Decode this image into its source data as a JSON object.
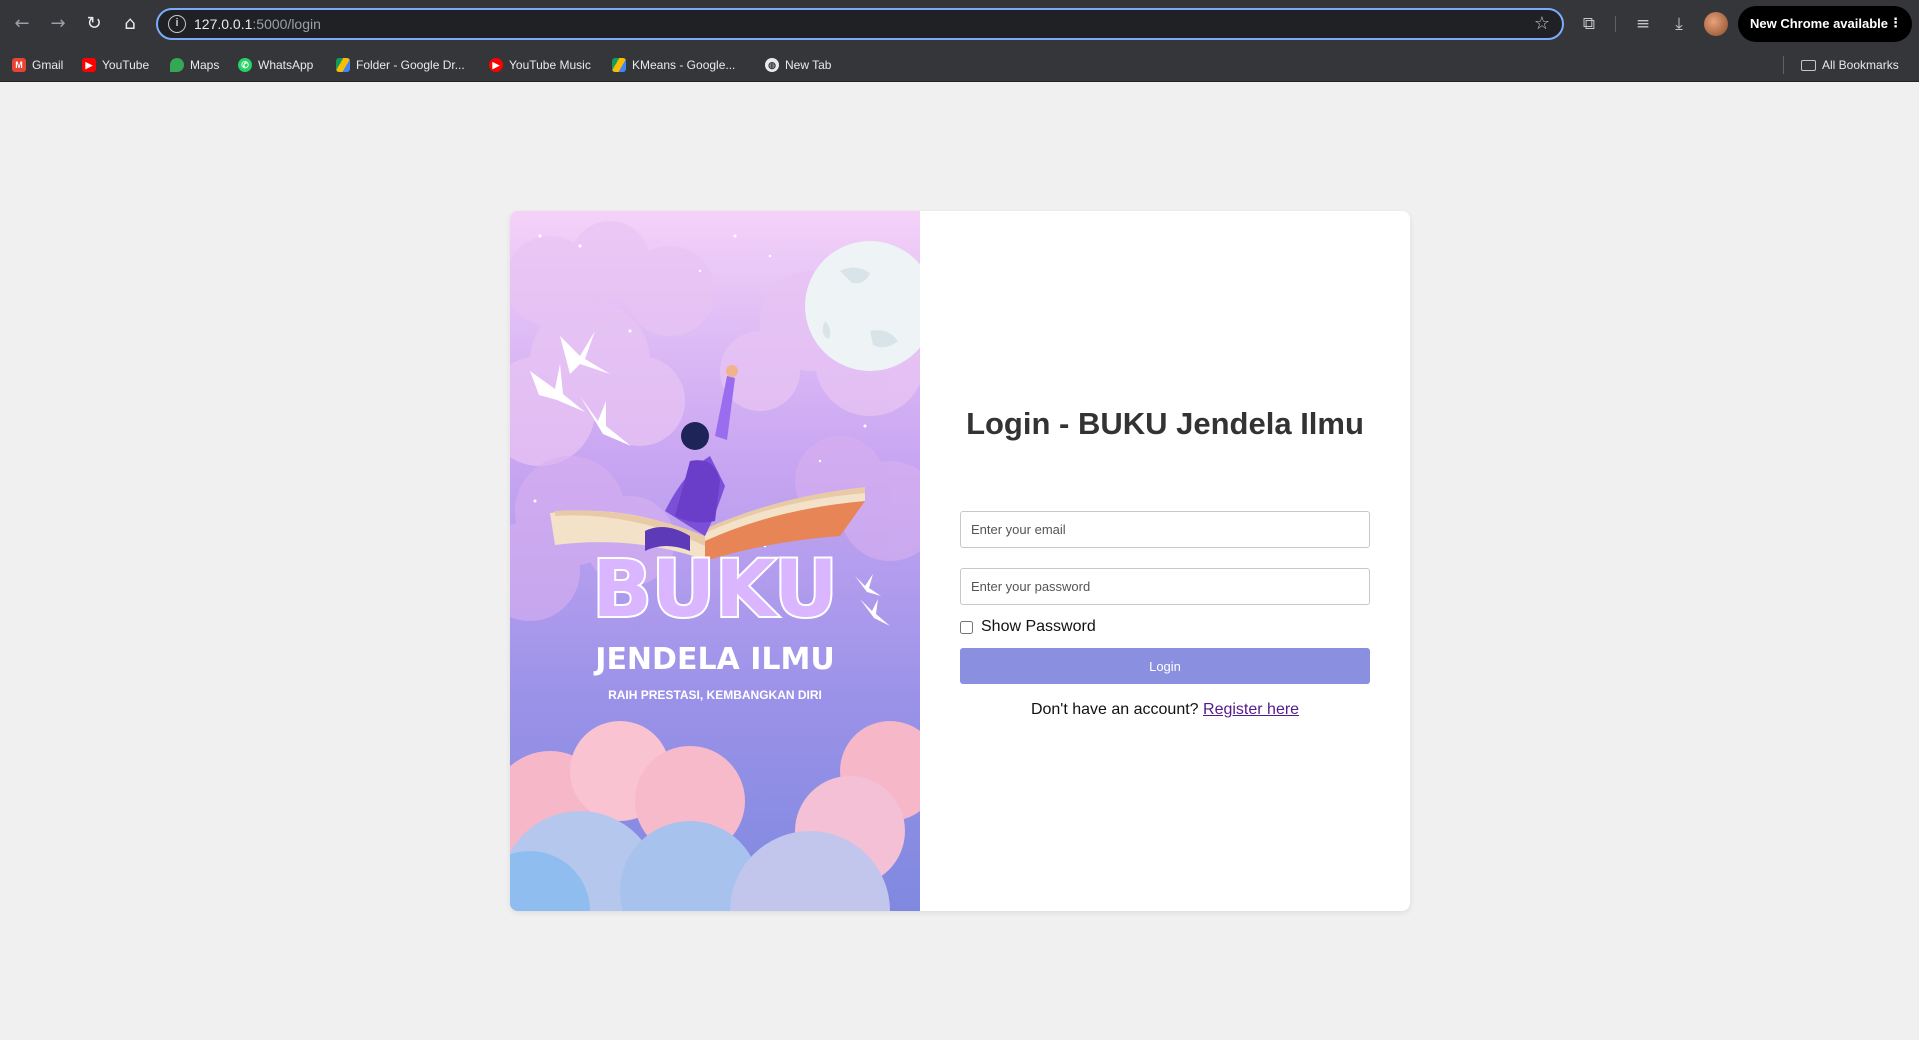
{
  "browser": {
    "url_host": "127.0.0.1",
    "url_path": ":5000/login",
    "update_label": "New Chrome available",
    "bookmarks": [
      {
        "label": "Gmail",
        "icon": "gmail-icon",
        "color": "#ea4335"
      },
      {
        "label": "YouTube",
        "icon": "youtube-icon",
        "color": "#ff0000"
      },
      {
        "label": "Maps",
        "icon": "maps-icon",
        "color": "#34a853"
      },
      {
        "label": "WhatsApp",
        "icon": "whatsapp-icon",
        "color": "#25d366"
      },
      {
        "label": "Folder - Google Dr...",
        "icon": "google-drive-icon",
        "color": "#fbbc04"
      },
      {
        "label": "YouTube Music",
        "icon": "youtube-music-icon",
        "color": "#ff0000"
      },
      {
        "label": "KMeans - Google...",
        "icon": "google-drive-icon",
        "color": "#fbbc04"
      },
      {
        "label": "New Tab",
        "icon": "globe-icon",
        "color": "#e8eaed"
      }
    ],
    "all_bookmarks_label": "All Bookmarks"
  },
  "banner": {
    "brand": "BUKU",
    "subtitle": "JENDELA ILMU",
    "tagline": "RAIH PRESTASI, KEMBANGKAN DIRI"
  },
  "login": {
    "title": "Login - BUKU Jendela Ilmu",
    "email_placeholder": "Enter your email",
    "email_value": "",
    "password_placeholder": "Enter your password",
    "password_value": "",
    "show_password_label": "Show Password",
    "show_password_checked": false,
    "submit_label": "Login",
    "register_prompt": "Don't have an account?",
    "register_link": "Register here"
  },
  "colors": {
    "accent": "#8a8fdf",
    "link": "#551a8b",
    "page_bg": "#f0f0f0"
  }
}
